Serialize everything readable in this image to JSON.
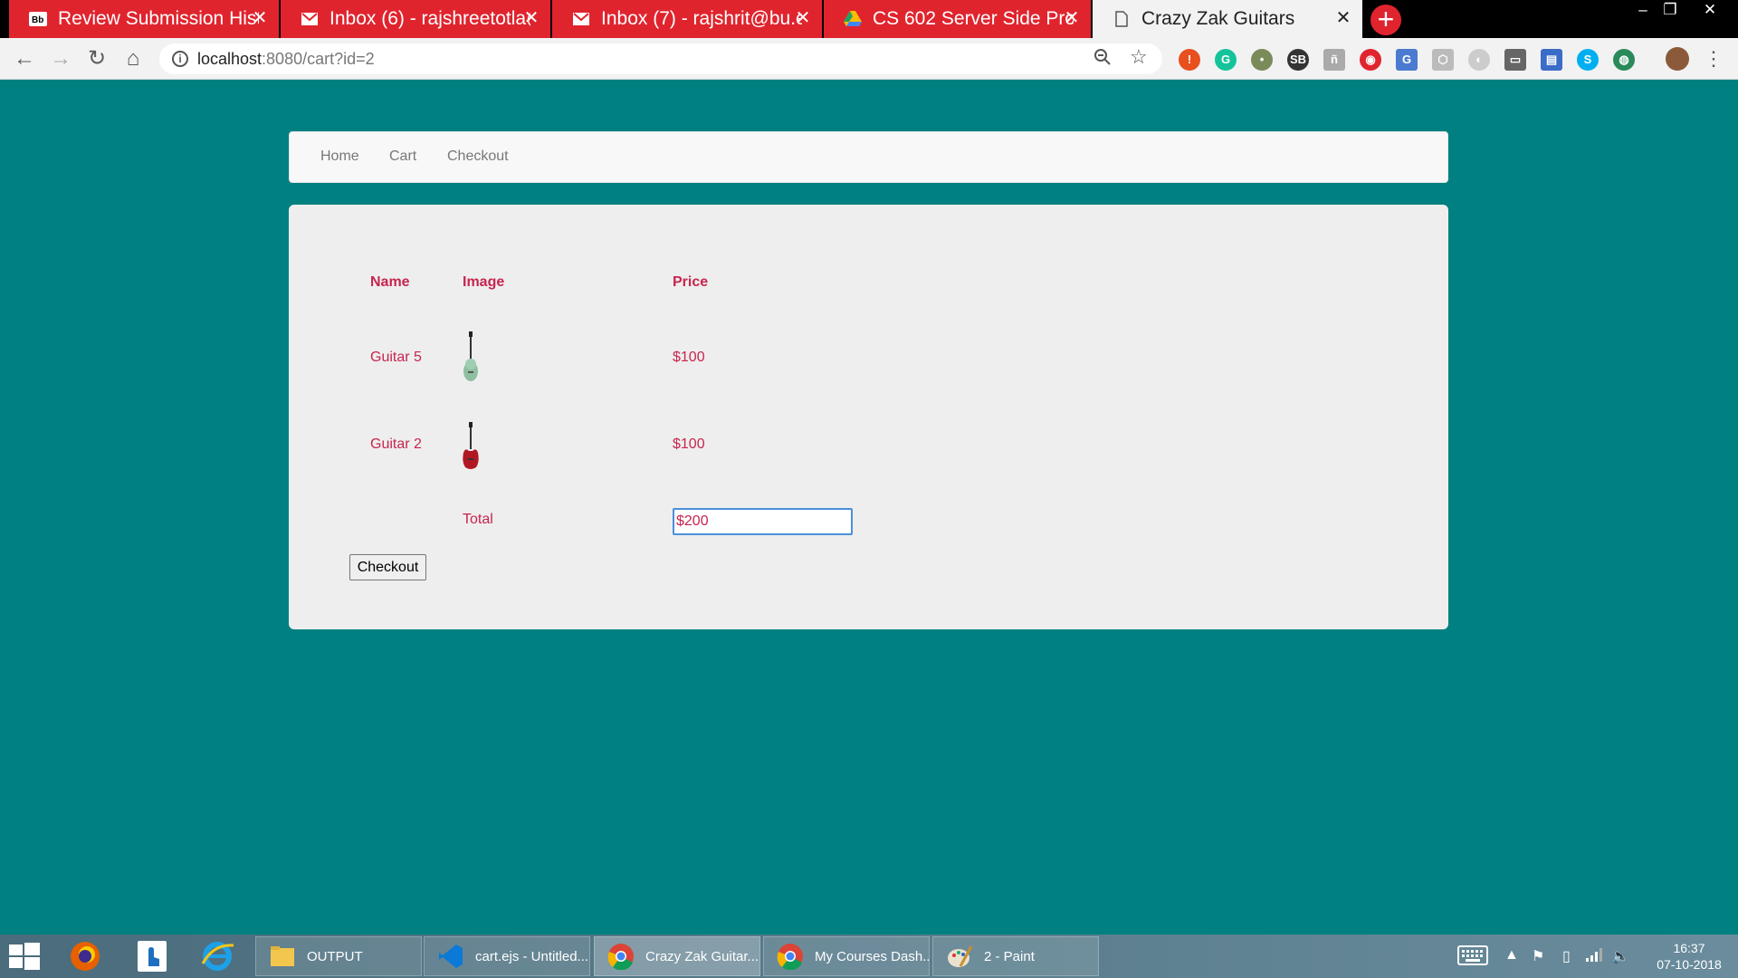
{
  "browser": {
    "tabs": [
      {
        "title": "Review Submission History",
        "icon": "blackboard-icon"
      },
      {
        "title": "Inbox (6) - rajshreetotla@",
        "icon": "gmail-icon"
      },
      {
        "title": "Inbox (7) - rajshrit@bu.edu",
        "icon": "gmail-icon"
      },
      {
        "title": "CS 602 Server Side Prog",
        "icon": "google-drive-icon"
      },
      {
        "title": "Crazy Zak Guitars",
        "icon": "page-icon"
      }
    ],
    "url_host": "localhost",
    "url_rest": ":8080/cart?id=2"
  },
  "nav": {
    "home": "Home",
    "cart": "Cart",
    "checkout": "Checkout"
  },
  "cart": {
    "headers": {
      "name": "Name",
      "image": "Image",
      "price": "Price"
    },
    "items": [
      {
        "name": "Guitar 5",
        "price": "$100",
        "guitar_color": "#8fbfa0"
      },
      {
        "name": "Guitar 2",
        "price": "$100",
        "guitar_color": "#b01822"
      }
    ],
    "total_label": "Total",
    "total_value": "$200",
    "checkout_button": "Checkout"
  },
  "taskbar": {
    "items": [
      {
        "label": "OUTPUT"
      },
      {
        "label": "cart.ejs - Untitled..."
      },
      {
        "label": "Crazy Zak Guitar..."
      },
      {
        "label": "My Courses Dash..."
      },
      {
        "label": "2 - Paint"
      }
    ],
    "time": "16:37",
    "date": "07-10-2018"
  },
  "colors": {
    "page_background": "#008080",
    "tab_red": "#e0242e",
    "text_accent": "#c7254e"
  }
}
